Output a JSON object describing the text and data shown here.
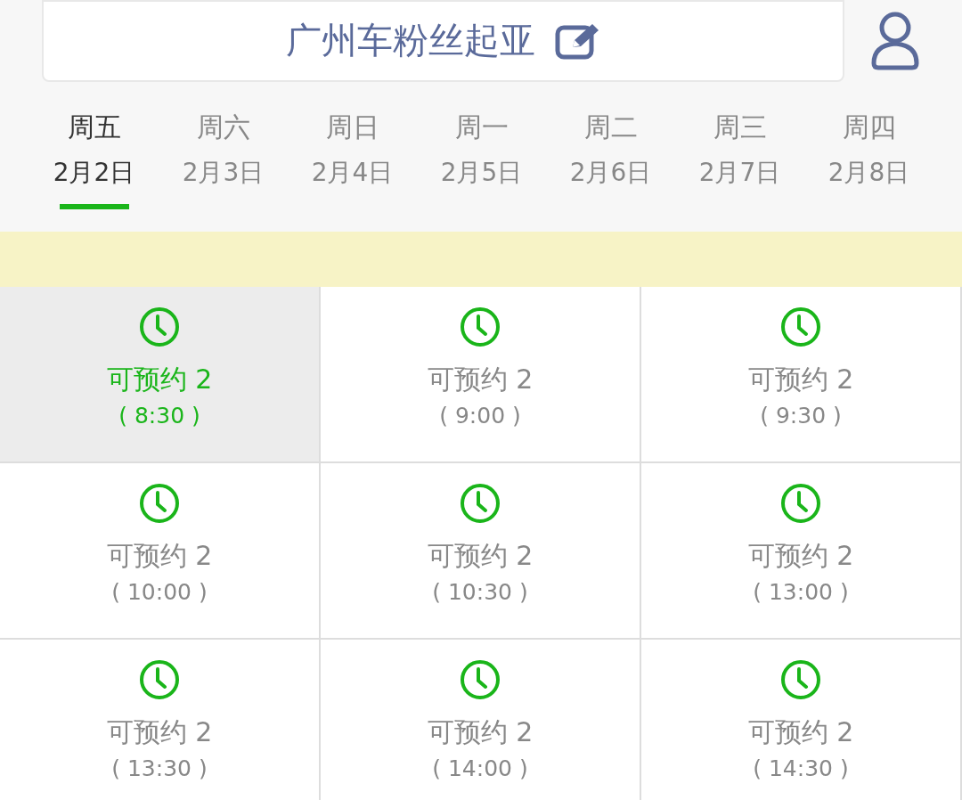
{
  "header": {
    "title": "广州车粉丝起亚"
  },
  "days": [
    {
      "weekday": "周五",
      "date": "2月2日",
      "selected": true
    },
    {
      "weekday": "周六",
      "date": "2月3日",
      "selected": false
    },
    {
      "weekday": "周日",
      "date": "2月4日",
      "selected": false
    },
    {
      "weekday": "周一",
      "date": "2月5日",
      "selected": false
    },
    {
      "weekday": "周二",
      "date": "2月6日",
      "selected": false
    },
    {
      "weekday": "周三",
      "date": "2月7日",
      "selected": false
    },
    {
      "weekday": "周四",
      "date": "2月8日",
      "selected": false
    }
  ],
  "slots": [
    {
      "status": "可预约 2",
      "time": "( 8:30 )",
      "selected": true
    },
    {
      "status": "可预约 2",
      "time": "( 9:00 )",
      "selected": false
    },
    {
      "status": "可预约 2",
      "time": "( 9:30 )",
      "selected": false
    },
    {
      "status": "可预约 2",
      "time": "( 10:00 )",
      "selected": false
    },
    {
      "status": "可预约 2",
      "time": "( 10:30 )",
      "selected": false
    },
    {
      "status": "可预约 2",
      "time": "( 13:00 )",
      "selected": false
    },
    {
      "status": "可预约 2",
      "time": "( 13:30 )",
      "selected": false
    },
    {
      "status": "可预约 2",
      "time": "( 14:00 )",
      "selected": false
    },
    {
      "status": "可预约 2",
      "time": "( 14:30 )",
      "selected": false
    }
  ]
}
